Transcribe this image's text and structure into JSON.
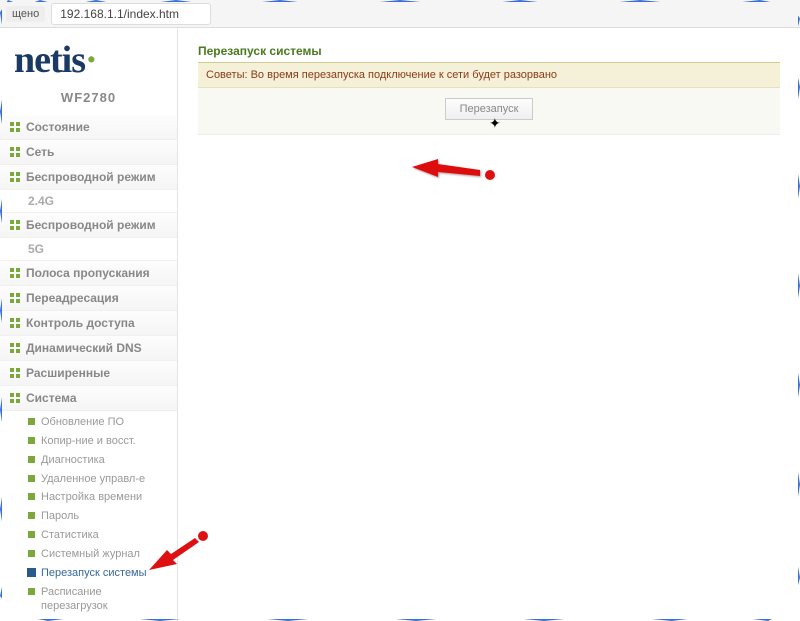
{
  "browser": {
    "secure_label": "щено",
    "url": "192.168.1.1/index.htm"
  },
  "brand": {
    "name": "netis",
    "model": "WF2780"
  },
  "sidebar": {
    "items": [
      {
        "label": "Состояние"
      },
      {
        "label": "Сеть"
      },
      {
        "label": "Беспроводной режим",
        "band": "2.4G"
      },
      {
        "label": "Беспроводной режим",
        "band": "5G"
      },
      {
        "label": "Полоса пропускания"
      },
      {
        "label": "Переадресация"
      },
      {
        "label": "Контроль доступа"
      },
      {
        "label": "Динамический DNS"
      },
      {
        "label": "Расширенные"
      },
      {
        "label": "Система"
      }
    ],
    "system_sub": [
      {
        "label": "Обновление ПО"
      },
      {
        "label": "Копир-ние и восст."
      },
      {
        "label": "Диагностика"
      },
      {
        "label": "Удаленное управл-е"
      },
      {
        "label": "Настройка времени"
      },
      {
        "label": "Пароль"
      },
      {
        "label": "Статистика"
      },
      {
        "label": "Системный журнал"
      },
      {
        "label": "Перезапуск системы",
        "active": true
      },
      {
        "label": "Расписание перезагрузок"
      }
    ]
  },
  "main": {
    "title": "Перезапуск системы",
    "tips": "Советы: Во время перезапуска подключение к сети будет разорвано",
    "restart_label": "Перезапуск"
  }
}
